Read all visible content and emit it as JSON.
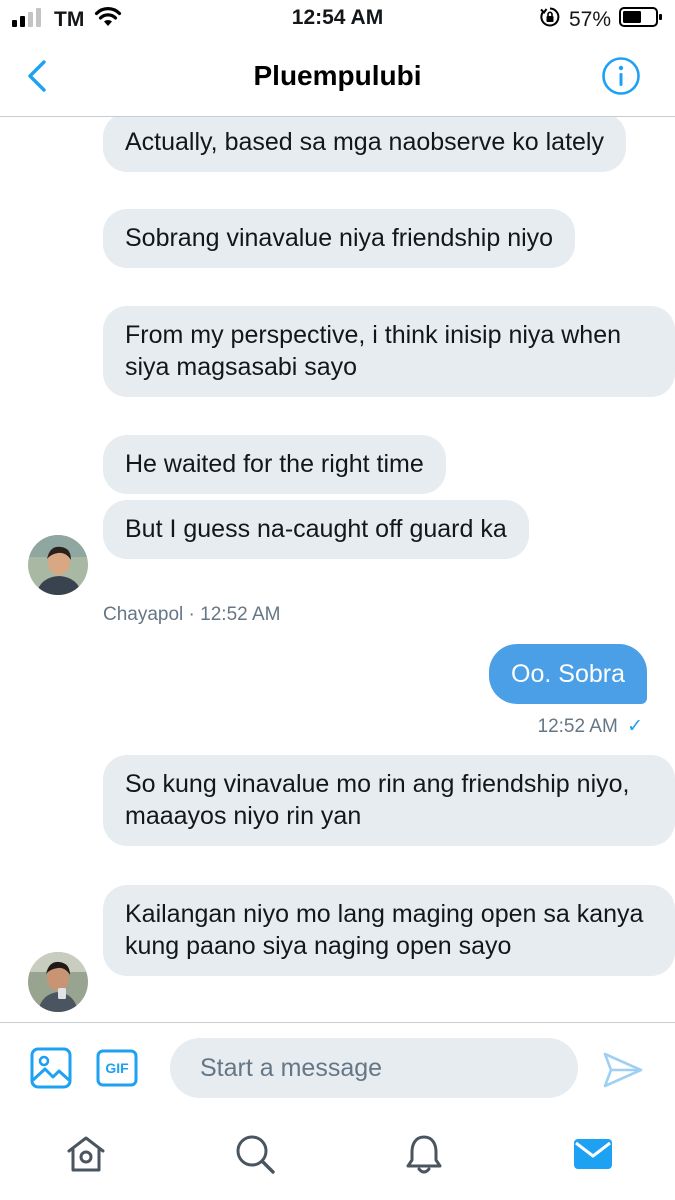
{
  "status_bar": {
    "carrier": "TM",
    "time": "12:54 AM",
    "battery": "57%"
  },
  "header": {
    "title": "Pluempulubi"
  },
  "messages": {
    "group1": [
      "Actually, based sa mga naobserve ko lately",
      "Sobrang vinavalue niya friendship niyo",
      "From my perspective, i think inisip niya when siya magsasabi sayo",
      "He waited for the right time",
      "But I guess na-caught off guard ka"
    ],
    "group1_meta": "Chayapol · 12:52 AM",
    "outgoing": "Oo. Sobra",
    "outgoing_meta": "12:52 AM",
    "outgoing_check": "✓",
    "group2": [
      "So kung vinavalue mo rin ang friendship niyo, maaayos niyo rin yan",
      "Kailangan niyo mo lang maging open sa kanya kung paano siya naging open sayo"
    ]
  },
  "composer": {
    "placeholder": "Start a message",
    "gif_label": "GIF"
  },
  "colors": {
    "accent": "#1da1f2",
    "outgoing_bubble": "#4a9fe6",
    "incoming_bubble": "#e6ecf0",
    "muted_text": "#657786"
  },
  "icons": {
    "status": [
      "signal-icon",
      "wifi-icon",
      "orientation-lock-icon",
      "battery-icon"
    ],
    "nav": [
      "back-chevron-icon",
      "info-icon"
    ],
    "composer": [
      "image-icon",
      "gif-icon",
      "send-icon"
    ],
    "tabs": [
      "home-icon",
      "search-icon",
      "notifications-bell-icon",
      "messages-envelope-icon"
    ]
  }
}
